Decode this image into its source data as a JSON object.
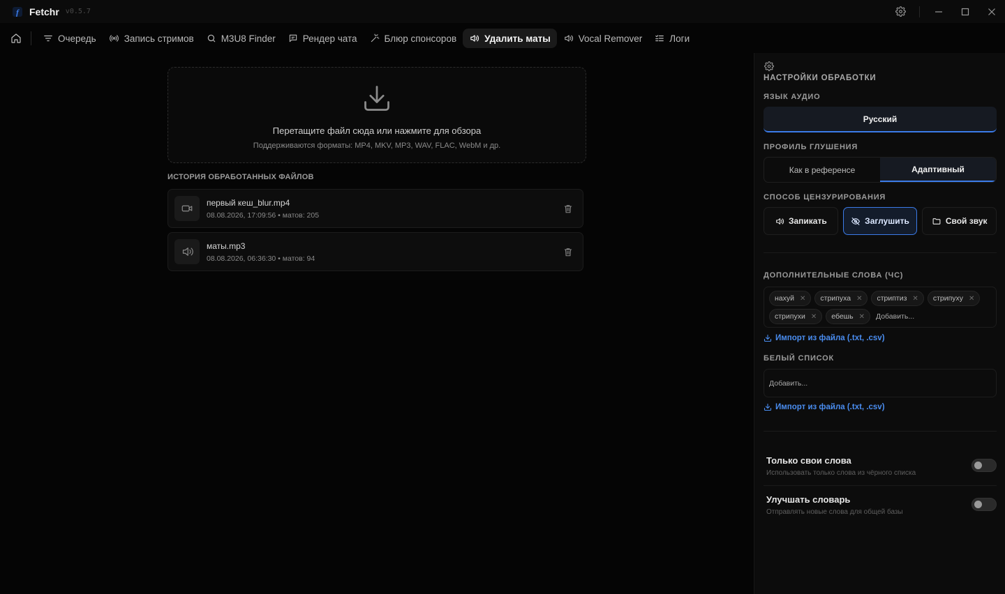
{
  "app": {
    "name": "Fetchr",
    "version": "v0.5.7"
  },
  "nav": {
    "items": [
      {
        "label": "Очередь",
        "icon": "filter-lines-icon"
      },
      {
        "label": "Запись стримов",
        "icon": "broadcast-icon"
      },
      {
        "label": "M3U8 Finder",
        "icon": "search-icon"
      },
      {
        "label": "Рендер чата",
        "icon": "chat-icon"
      },
      {
        "label": "Блюр спонсоров",
        "icon": "wand-icon"
      },
      {
        "label": "Удалить маты",
        "icon": "speaker-icon",
        "active": true
      },
      {
        "label": "Vocal Remover",
        "icon": "speaker-icon"
      },
      {
        "label": "Логи",
        "icon": "list-check-icon"
      }
    ]
  },
  "dropzone": {
    "title": "Перетащите файл сюда или нажмите для обзора",
    "subtitle": "Поддерживаются форматы: MP4, MKV, MP3, WAV, FLAC, WebM и др."
  },
  "history": {
    "title": "ИСТОРИЯ ОБРАБОТАННЫХ ФАЙЛОВ",
    "items": [
      {
        "name": "первый кеш_blur.mp4",
        "meta": "08.08.2026, 17:09:56 • матов: 205",
        "icon": "video-camera-icon"
      },
      {
        "name": "маты.mp3",
        "meta": "08.08.2026, 06:36:30 • матов: 94",
        "icon": "speaker-icon"
      }
    ]
  },
  "panel": {
    "title": "НАСТРОЙКИ ОБРАБОТКИ",
    "language": {
      "label": "ЯЗЫК АУДИО",
      "value": "Русский"
    },
    "profile": {
      "label": "ПРОФИЛЬ ГЛУШЕНИЯ",
      "options": [
        "Как в референсе",
        "Адаптивный"
      ],
      "selected": "Адаптивный"
    },
    "censor": {
      "label": "СПОСОБ ЦЕНЗУРИРОВАНИЯ",
      "options": [
        "Запикать",
        "Заглушить",
        "Свой звук"
      ],
      "selected": "Заглушить"
    },
    "blacklist": {
      "label": "ДОПОЛНИТЕЛЬНЫЕ СЛОВА (ЧС)",
      "words": [
        "нахуй",
        "стрипуха",
        "стриптиз",
        "стрипуху",
        "стрипухи",
        "ебешь"
      ],
      "placeholder": "Добавить...",
      "import_label": "Импорт из файла (.txt, .csv)"
    },
    "whitelist": {
      "label": "БЕЛЫЙ СПИСОК",
      "placeholder": "Добавить...",
      "import_label": "Импорт из файла (.txt, .csv)"
    },
    "toggles": [
      {
        "title": "Только свои слова",
        "subtitle": "Использовать только слова из чёрного списка",
        "on": false
      },
      {
        "title": "Улучшать словарь",
        "subtitle": "Отправлять новые слова для общей базы",
        "on": false
      }
    ]
  },
  "colors": {
    "accent": "#3b7be8",
    "link": "#4a8df0",
    "background": "#050505",
    "panel": "#0c0c0c"
  }
}
